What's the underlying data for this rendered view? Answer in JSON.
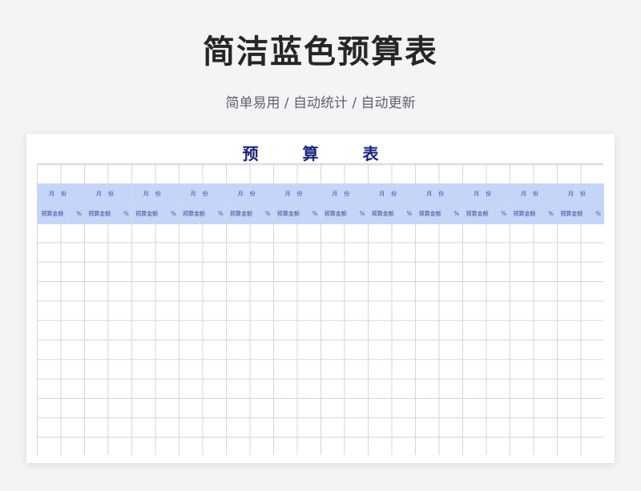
{
  "page": {
    "title": "简洁蓝色预算表",
    "subtitle": "简单易用 / 自动统计 / 自动更新"
  },
  "sheet": {
    "title": "预 算 表",
    "month_label": "月份",
    "amount_label": "预算金额",
    "percent_label": "%",
    "month_count": 12,
    "colors": {
      "header_fill": "#c5d5fa",
      "header_text": "#3d4a8a",
      "title_text": "#1a237e",
      "grid_line": "#d4d6da"
    }
  }
}
